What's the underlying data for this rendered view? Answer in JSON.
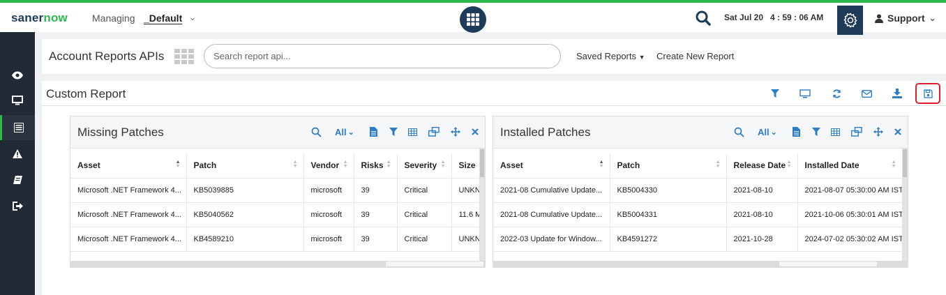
{
  "brand": {
    "part1": "saner",
    "part2": "now"
  },
  "header": {
    "managing_label": "Managing",
    "tenant": "_Default",
    "datetime": "Sat Jul 20   4 : 59 : 06 AM",
    "user": "Support"
  },
  "sidebar": {
    "items": [
      "eye-icon",
      "monitor-icon",
      "report-list-icon",
      "alert-icon",
      "book-icon",
      "logout-icon"
    ],
    "active_index": 2
  },
  "api_bar": {
    "title": "Account Reports APIs",
    "search_placeholder": "Search report api...",
    "saved_reports": "Saved Reports",
    "create_new": "Create New Report"
  },
  "report": {
    "title": "Custom Report",
    "tools": [
      "filter-icon",
      "monitor-icon",
      "refresh-icon",
      "email-icon",
      "download-icon",
      "save-icon"
    ]
  },
  "widgets": [
    {
      "title": "Missing Patches",
      "filter_value": "All",
      "columns": [
        "Asset",
        "Patch",
        "Vendor",
        "Risks",
        "Severity",
        "Size"
      ],
      "rows": [
        [
          "Microsoft .NET Framework 4...",
          "KB5039885",
          "microsoft",
          "39",
          "Critical",
          "UNKN"
        ],
        [
          "Microsoft .NET Framework 4...",
          "KB5040562",
          "microsoft",
          "39",
          "Critical",
          "11.6 M"
        ],
        [
          "Microsoft .NET Framework 4...",
          "KB4589210",
          "microsoft",
          "39",
          "Critical",
          "UNKN"
        ]
      ]
    },
    {
      "title": "Installed Patches",
      "filter_value": "All",
      "columns": [
        "Asset",
        "Patch",
        "Release Date",
        "Installed Date"
      ],
      "rows": [
        [
          "2021-08 Cumulative Update...",
          "KB5004330",
          "2021-08-10",
          "2021-08-07 05:30:00 AM IST"
        ],
        [
          "2021-08 Cumulative Update...",
          "KB5004331",
          "2021-08-10",
          "2021-10-06 05:30:01 AM IST"
        ],
        [
          "2022-03 Update for Window...",
          "KB4591272",
          "2021-10-28",
          "2024-07-02 05:30:02 AM IST"
        ]
      ]
    }
  ],
  "colors": {
    "brand_green": "#2db84a",
    "navy": "#1f3b5a",
    "accent_blue": "#2c7cc7",
    "highlight_red": "#e01e2b"
  }
}
